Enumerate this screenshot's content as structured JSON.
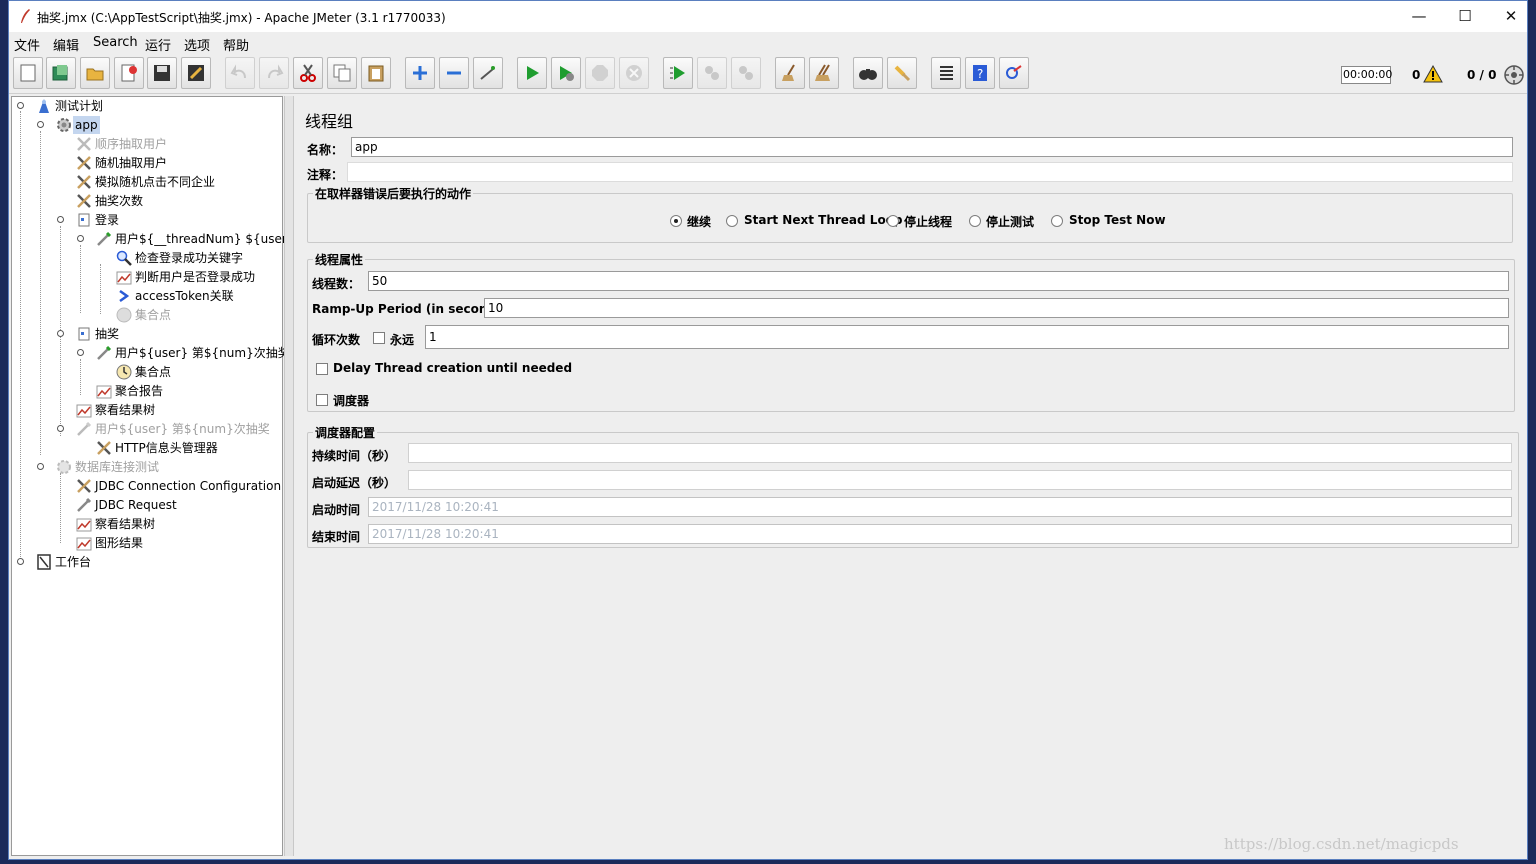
{
  "window": {
    "title": "抽奖.jmx (C:\\AppTestScript\\抽奖.jmx) - Apache JMeter (3.1 r1770033)",
    "minimize": "—",
    "maximize": "☐",
    "close": "✕"
  },
  "menu": [
    "文件",
    "编辑",
    "Search",
    "运行",
    "选项",
    "帮助"
  ],
  "toolbar": {
    "timer": "00:00:00",
    "error_count": "0",
    "threads": "0 / 0"
  },
  "tree": [
    {
      "label": "测试计划",
      "icon": "test-plan-icon"
    },
    {
      "label": "app",
      "icon": "thread-group-icon"
    },
    {
      "label": "顺序抽取用户",
      "icon": "config-wrench-icon"
    },
    {
      "label": "随机抽取用户",
      "icon": "config-wrench-icon"
    },
    {
      "label": "模拟随机点击不同企业",
      "icon": "config-wrench-icon"
    },
    {
      "label": "抽奖次数",
      "icon": "config-wrench-icon"
    },
    {
      "label": "登录",
      "icon": "transaction-controller-icon"
    },
    {
      "label": "用户${__threadNum}  ${user}",
      "icon": "sampler-pipette-icon"
    },
    {
      "label": "检查登录成功关键字",
      "icon": "assertion-magnifier-icon"
    },
    {
      "label": "判断用户是否登录成功",
      "icon": "listener-graph-icon"
    },
    {
      "label": "accessToken关联",
      "icon": "post-processor-arrow-icon"
    },
    {
      "label": "集合点",
      "icon": "timer-clock-icon"
    },
    {
      "label": "抽奖",
      "icon": "transaction-controller-icon"
    },
    {
      "label": "用户${user} 第${num}次抽奖",
      "icon": "sampler-pipette-icon"
    },
    {
      "label": "集合点",
      "icon": "timer-clock-icon"
    },
    {
      "label": "聚合报告",
      "icon": "listener-graph-icon"
    },
    {
      "label": "察看结果树",
      "icon": "listener-graph-icon"
    },
    {
      "label": "用户${user} 第${num}次抽奖",
      "icon": "sampler-pipette-icon"
    },
    {
      "label": "HTTP信息头管理器",
      "icon": "config-wrench-icon"
    },
    {
      "label": "数据库连接测试",
      "icon": "thread-group-icon"
    },
    {
      "label": "JDBC Connection Configuration",
      "icon": "config-wrench-icon"
    },
    {
      "label": "JDBC Request",
      "icon": "sampler-pipette-icon"
    },
    {
      "label": "察看结果树",
      "icon": "listener-graph-icon"
    },
    {
      "label": "图形结果",
      "icon": "listener-graph-icon"
    },
    {
      "label": "工作台",
      "icon": "workbench-icon"
    }
  ],
  "panel": {
    "title": "线程组",
    "name_label": "名称：",
    "name_value": "app",
    "comment_label": "注释：",
    "comment_value": "",
    "error_group_title": "在取样器错误后要执行的动作",
    "error_options": [
      "继续",
      "Start Next Thread Loop",
      "停止线程",
      "停止测试",
      "Stop Test Now"
    ],
    "thread_props_title": "线程属性",
    "threads_label": "线程数：",
    "threads_value": "50",
    "rampup_label": "Ramp-Up Period (in seconds):",
    "rampup_value": "10",
    "loop_label": "循环次数",
    "forever_label": "永远",
    "loop_value": "1",
    "delay_label": "Delay Thread creation until needed",
    "scheduler_label": "调度器",
    "scheduler_group_title": "调度器配置",
    "duration_label": "持续时间（秒）",
    "duration_value": "",
    "startup_delay_label": "启动延迟（秒）",
    "startup_delay_value": "",
    "start_time_label": "启动时间",
    "start_time_value": "2017/11/28 10:20:41",
    "end_time_label": "结束时间",
    "end_time_value": "2017/11/28 10:20:41"
  },
  "watermark": "https://blog.csdn.net/magicpds"
}
